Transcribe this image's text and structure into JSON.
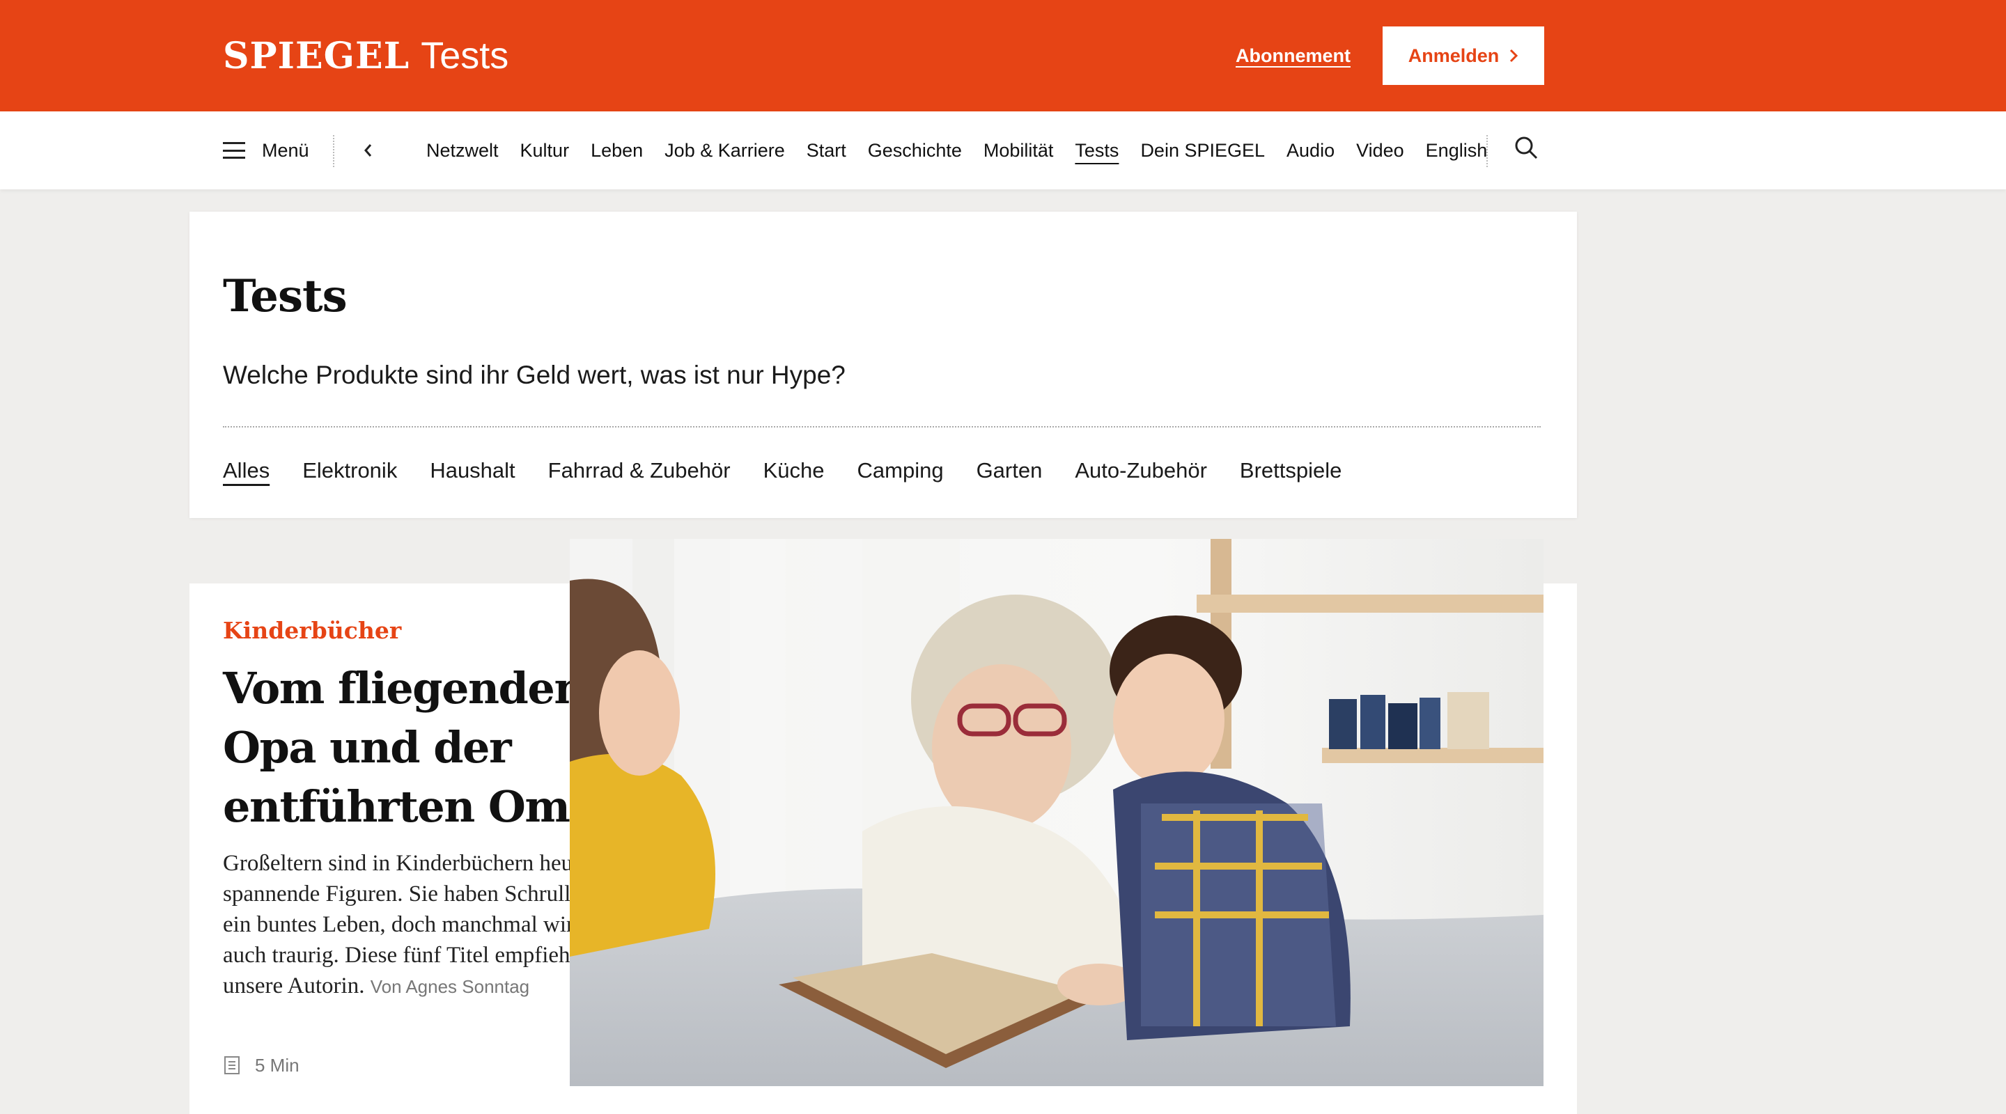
{
  "header": {
    "brand": "SPIEGEL",
    "section": "Tests",
    "subscribe_label": "Abonnement",
    "login_label": "Anmelden"
  },
  "nav": {
    "menu_label": "Menü",
    "links": [
      "Netzwelt",
      "Kultur",
      "Leben",
      "Job & Karriere",
      "Start",
      "Geschichte",
      "Mobilität",
      "Tests",
      "Dein SPIEGEL",
      "Audio",
      "Video",
      "English"
    ],
    "active": "Tests"
  },
  "page": {
    "title": "Tests",
    "tagline": "Welche Produkte sind ihr Geld wert, was ist nur Hype?",
    "categories": [
      "Alles",
      "Elektronik",
      "Haushalt",
      "Fahrrad & Zubehör",
      "Küche",
      "Camping",
      "Garten",
      "Auto-Zubehör",
      "Brettspiele"
    ],
    "active_category": "Alles"
  },
  "article": {
    "kicker": "Kinderbücher",
    "headline": "Vom fliegenden Opa und der entführten Oma",
    "teaser": "Großeltern sind in Kinderbüchern heute oft spannende Figuren. Sie haben Schrullen und ein buntes Leben, doch manchmal wird es auch traurig. Diese fünf Titel empfiehlt unsere Autorin.",
    "byline": "Von Agnes Sonntag",
    "read_time": "5 Min"
  },
  "colors": {
    "brand": "#e64415",
    "page_bg": "#efeeec"
  },
  "icons": [
    "menu-icon",
    "chevron-left-icon",
    "search-icon",
    "chevron-right-icon",
    "article-doc-icon",
    "bookmark-icon"
  ]
}
